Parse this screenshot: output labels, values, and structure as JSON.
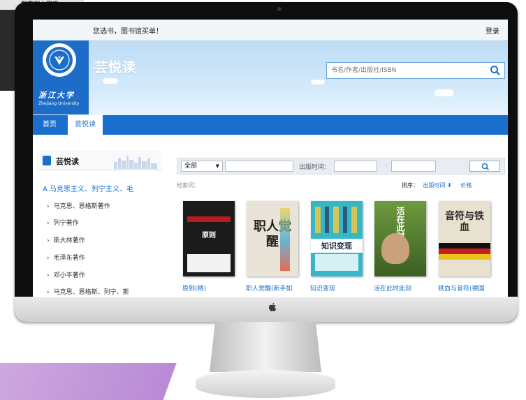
{
  "background": {
    "paper_text": "剩景剩土固夭"
  },
  "topbar": {
    "slogan": "您选书，图书馆买单！",
    "login": "登录"
  },
  "logo": {
    "name_cn": "浙江大学",
    "name_en": "Zhejiang University"
  },
  "banner": {
    "site_title": "芸悦读"
  },
  "search": {
    "placeholder": "书名/作者/出版社/ISBN"
  },
  "nav": {
    "items": [
      {
        "label": "首页"
      },
      {
        "label": "芸悦读"
      }
    ]
  },
  "sidebar": {
    "title": "芸悦读",
    "category": "A 马克思主义、列宁主义、毛",
    "subitems": [
      {
        "label": "马克思、恩格斯著作"
      },
      {
        "label": "列宁著作"
      },
      {
        "label": "斯大林著作"
      },
      {
        "label": "毛泽东著作"
      },
      {
        "label": "邓小平著作"
      },
      {
        "label": "马克思、恩格斯、列宁、斯"
      }
    ]
  },
  "filter": {
    "select_value": "全部",
    "pub_time_label": "出版时间：",
    "dash": "-",
    "keyword_label": "检索词：",
    "sort_label": "排序：",
    "sort_pub": "出版时间",
    "sort_price": "价格"
  },
  "books": [
    {
      "title": "原则(精)",
      "cover_text": "原则",
      "cover_color": "#1b1b1b"
    },
    {
      "title": "职人觉醒(新手如",
      "cover_text": "职人觉醒",
      "cover_color": "#e9e4d7"
    },
    {
      "title": "知识变现",
      "cover_text": "知识变现",
      "cover_color": "#35b7c8"
    },
    {
      "title": "活在此时此刻",
      "cover_text": "活在此时此刻",
      "cover_color": "#4f7d2d"
    },
    {
      "title": "铁血与音符(德国",
      "cover_text": "音符与铁血",
      "cover_color": "#e8e1cf"
    }
  ],
  "colors": {
    "brand_blue": "#1a6fcc",
    "banner_sky": "#bcdcf5"
  }
}
